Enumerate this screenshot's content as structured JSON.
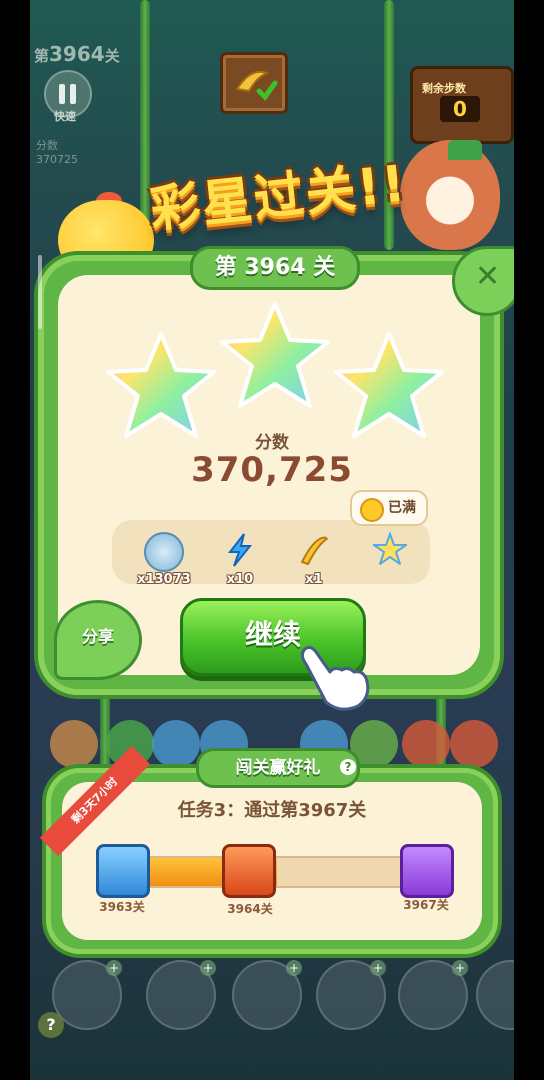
{
  "hud": {
    "level_prefix": "第",
    "level_number": "3964",
    "level_suffix": "关",
    "speed_label": "快速",
    "score_label": "分数",
    "score_value": "370725",
    "moves_label": "剩余步数",
    "moves_value": "0"
  },
  "result": {
    "title": "彩星过关!!",
    "level_banner": "第 3964 关",
    "stars_earned": 3,
    "stars_total": 3,
    "score_label": "分数",
    "score_value": "370,725"
  },
  "rewards": [
    {
      "icon": "silver-coin-icon",
      "count": "x13073"
    },
    {
      "icon": "lightning-icon",
      "count": "x10"
    },
    {
      "icon": "banana-icon",
      "count": "x1"
    },
    {
      "icon": "star-trophy-icon",
      "count": ""
    }
  ],
  "full_badge": "已满",
  "share_label": "分享",
  "continue_label": "继续",
  "task": {
    "banner": "闯关赢好礼",
    "ribbon": "剩3天7小时",
    "text": "任务3：通过第3967关",
    "progress": 0.5,
    "milestones": [
      {
        "label": "3963关",
        "chest": "blue"
      },
      {
        "label": "3964关",
        "chest": "red"
      },
      {
        "label": "3967关",
        "chest": "purple"
      }
    ]
  },
  "colors": {
    "card_bg": "#fbf2d8",
    "leaf_green": "#5fb644",
    "button_green": "#49c42a",
    "progress_orange": "#f08f12"
  }
}
